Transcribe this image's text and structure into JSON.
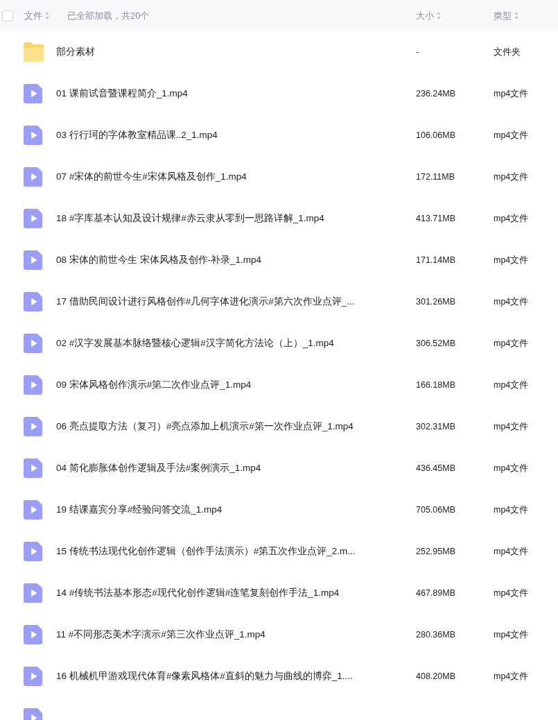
{
  "header": {
    "select_all": {
      "checked": false
    },
    "name_label": "文件",
    "status": "已全部加载，共20个",
    "size_label": "大小",
    "type_label": "类型"
  },
  "rows": [
    {
      "kind": "folder",
      "name": "部分素材",
      "size": "-",
      "type": "文件夹"
    },
    {
      "kind": "video",
      "name": "01 课前试音暨课程简介_1.mp4",
      "size": "236.24MB",
      "type": "mp4文件"
    },
    {
      "kind": "video",
      "name": "03 行行珂的字体教室精品课..2_1.mp4",
      "size": "106.06MB",
      "type": "mp4文件"
    },
    {
      "kind": "video",
      "name": "07 #宋体的前世今生#宋体风格及创作_1.mp4",
      "size": "172.11MB",
      "type": "mp4文件"
    },
    {
      "kind": "video",
      "name": "18 #字库基本认知及设计规律#赤云隶从零到一思路详解_1.mp4",
      "size": "413.71MB",
      "type": "mp4文件"
    },
    {
      "kind": "video",
      "name": "08 宋体的前世今生 宋体风格及创作-补录_1.mp4",
      "size": "171.14MB",
      "type": "mp4文件"
    },
    {
      "kind": "video",
      "name": "17 借助民间设计进行风格创作#几何字体进化演示#第六次作业点评_...",
      "size": "301.26MB",
      "type": "mp4文件"
    },
    {
      "kind": "video",
      "name": "02 #汉字发展基本脉络暨核心逻辑#汉字简化方法论（上）_1.mp4",
      "size": "306.52MB",
      "type": "mp4文件"
    },
    {
      "kind": "video",
      "name": "09 宋体风格创作演示#第二次作业点评_1.mp4",
      "size": "166.18MB",
      "type": "mp4文件"
    },
    {
      "kind": "video",
      "name": "06 亮点提取方法（复习）#亮点添加上机演示#第一次作业点评_1.mp4",
      "size": "302.31MB",
      "type": "mp4文件"
    },
    {
      "kind": "video",
      "name": "04 简化膨胀体创作逻辑及手法#案例演示_1.mp4",
      "size": "436.45MB",
      "type": "mp4文件"
    },
    {
      "kind": "video",
      "name": "19 结课嘉宾分享#经验问答交流_1.mp4",
      "size": "705.06MB",
      "type": "mp4文件"
    },
    {
      "kind": "video",
      "name": "15 传统书法现代化创作逻辑（创作手法演示）#第五次作业点评_2.m...",
      "size": "252.95MB",
      "type": "mp4文件"
    },
    {
      "kind": "video",
      "name": "14 #传统书法基本形态#现代化创作逻辑#连笔复刻创作手法_1.mp4",
      "size": "467.89MB",
      "type": "mp4文件"
    },
    {
      "kind": "video",
      "name": "11 #不同形态美术字演示#第三次作业点评_1.mp4",
      "size": "280.36MB",
      "type": "mp4文件"
    },
    {
      "kind": "video",
      "name": "16 机械机甲游戏现代体育#像素风格体#直斜的魅力与曲线的博弈_1....",
      "size": "408.20MB",
      "type": "mp4文件"
    },
    {
      "kind": "video"
    }
  ]
}
